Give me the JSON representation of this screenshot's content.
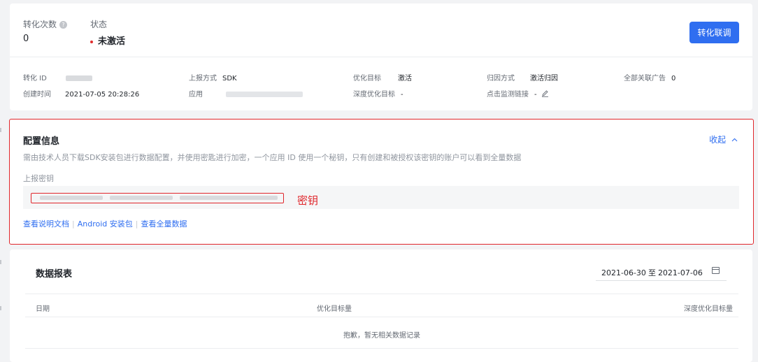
{
  "summary": {
    "conversion_count_label": "转化次数",
    "conversion_count_value": "0",
    "status_label": "状态",
    "status_value": "未激活",
    "link_button": "转化联调"
  },
  "info": {
    "conversion_id_label": "转化 ID",
    "created_time_label": "创建时间",
    "created_time_value": "2021-07-05 20:28:26",
    "report_method_label": "上报方式",
    "report_method_value": "SDK",
    "app_label": "应用",
    "optimization_target_label": "优化目标",
    "optimization_target_value": "激活",
    "deep_optimization_target_label": "深度优化目标",
    "deep_optimization_target_value": "-",
    "attribution_method_label": "归因方式",
    "attribution_method_value": "激活归因",
    "click_monitor_link_label": "点击监测链接",
    "click_monitor_link_value": "-",
    "linked_ads_label": "全部关联广告",
    "linked_ads_value": "0"
  },
  "config": {
    "title": "配置信息",
    "collapse": "收起",
    "description": "需由技术人员下载SDK安装包进行数据配置，并使用密匙进行加密，一个应用 ID 使用一个秘钥，只有创建和被授权该密钥的账户可以看到全量数据",
    "key_label": "上报密钥",
    "key_annotation": "密钥",
    "links": [
      "查看说明文档",
      "Android 安装包",
      "查看全量数据"
    ]
  },
  "report": {
    "title": "数据报表",
    "date_start": "2021-06-30",
    "date_to": "至",
    "date_end": "2021-07-06",
    "columns": [
      "日期",
      "优化目标量",
      "深度优化目标量"
    ],
    "empty_text": "抱歉，暂无相关数据记录"
  },
  "colors": {
    "accent": "#2f6ef0",
    "alert": "#e0262b"
  }
}
